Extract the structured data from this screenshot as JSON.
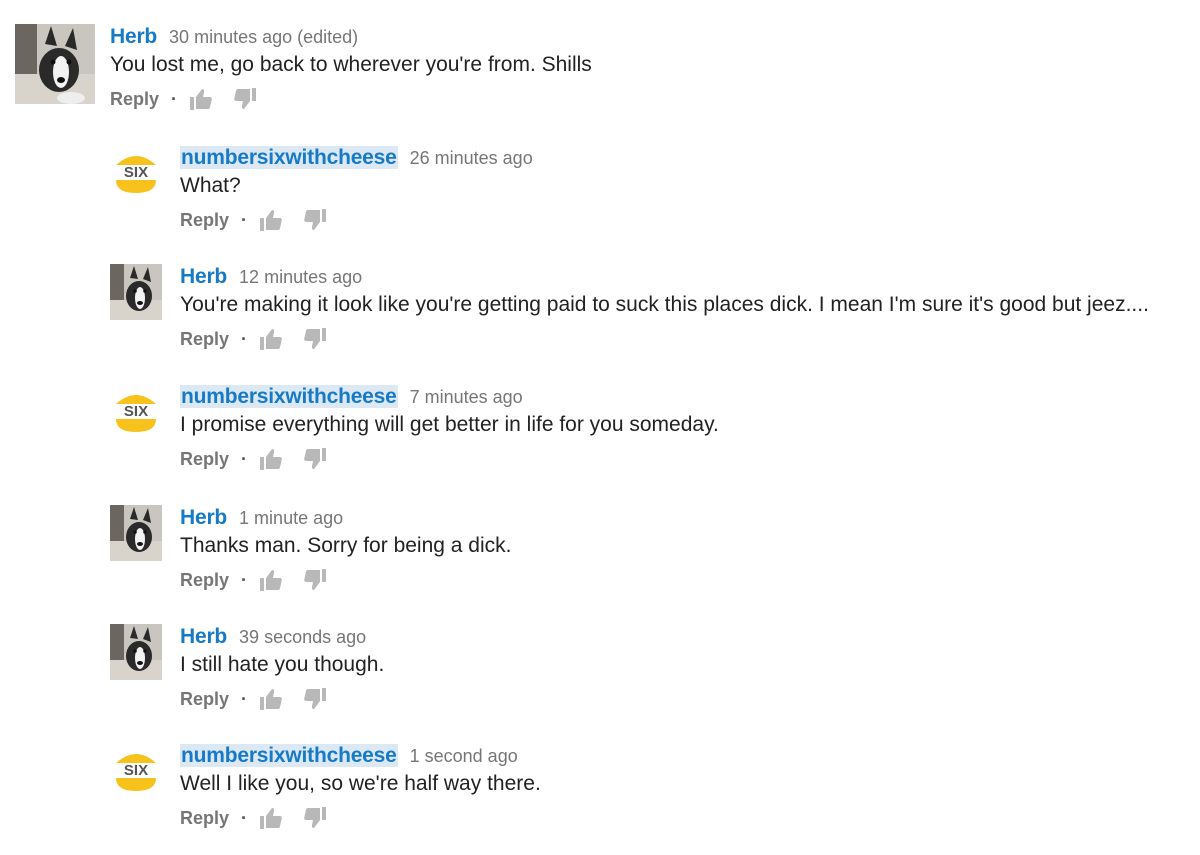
{
  "comments": [
    {
      "author": "Herb",
      "time": "30 minutes ago (edited)",
      "text": "You lost me, go back to wherever you're from. Shills",
      "avatar": "dog"
    },
    {
      "author": "numbersixwithcheese",
      "time": "26 minutes ago",
      "text": "What?",
      "avatar": "burger"
    },
    {
      "author": "Herb",
      "time": "12 minutes ago",
      "text": "You're making it look like you're getting paid to suck this places dick.  I mean I'm sure it's good but jeez....",
      "avatar": "dog"
    },
    {
      "author": "numbersixwithcheese",
      "time": "7 minutes ago",
      "text": "I promise everything will get better in life for you someday.",
      "avatar": "burger"
    },
    {
      "author": "Herb",
      "time": "1 minute ago",
      "text": "Thanks man. Sorry for being a dick.",
      "avatar": "dog"
    },
    {
      "author": "Herb",
      "time": "39 seconds ago",
      "text": "I still hate you though.",
      "avatar": "dog"
    },
    {
      "author": "numbersixwithcheese",
      "time": "1 second ago",
      "text": "Well I like you, so we're half way there.",
      "avatar": "burger"
    }
  ],
  "ui": {
    "reply_label": "Reply",
    "separator": "·",
    "like_icon": "thumbs-up-icon",
    "dislike_icon": "thumbs-down-icon"
  },
  "burger_logo_text": "SIX",
  "colors": {
    "author": "#167ac6",
    "author_highlight": "#dde8f5",
    "meta": "#767676",
    "text": "#222222",
    "icon": "#b8b8b8",
    "burger": "#f6c21b"
  }
}
